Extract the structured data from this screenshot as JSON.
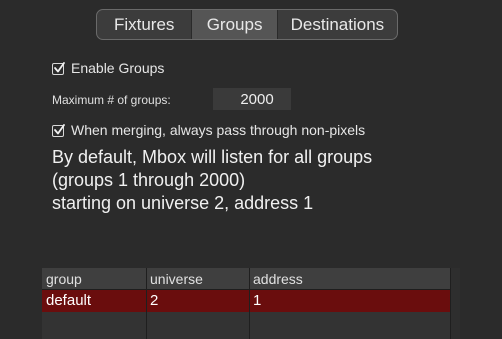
{
  "tabs": [
    {
      "label": "Fixtures",
      "selected": false
    },
    {
      "label": "Groups",
      "selected": true
    },
    {
      "label": "Destinations",
      "selected": false
    }
  ],
  "enable_groups": {
    "label": "Enable Groups",
    "checked": true
  },
  "max_groups": {
    "label": "Maximum # of groups:",
    "value": "2000"
  },
  "passthrough": {
    "label": "When merging, always pass through non-pixels",
    "checked": true
  },
  "description": [
    "By default, Mbox will listen for all groups",
    "(groups 1 through 2000)",
    "starting on universe 2, address 1"
  ],
  "table": {
    "headers": [
      "group",
      "universe",
      "address"
    ],
    "rows": [
      {
        "group": "default",
        "universe": "2",
        "address": "1",
        "selected": true
      }
    ]
  },
  "colors": {
    "background": "#2b2b2b",
    "selected_row": "#6a0d0d",
    "selected_tab": "#555555"
  }
}
